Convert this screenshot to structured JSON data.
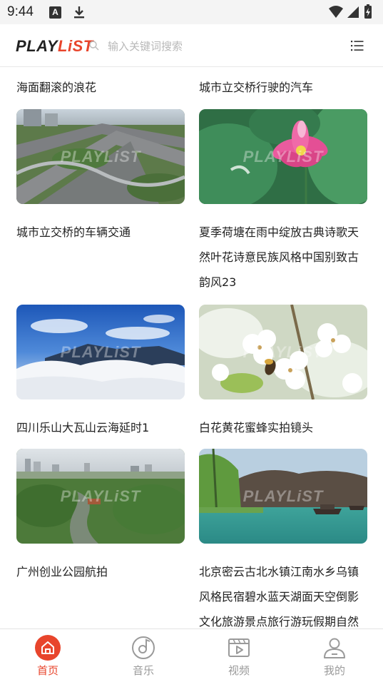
{
  "status_bar": {
    "time": "9:44",
    "notification_letter": "A"
  },
  "header": {
    "logo_play": "PLAY",
    "logo_list": "LiST",
    "search_placeholder": "输入关键词搜索"
  },
  "feed": {
    "watermark": "PLAYLiST",
    "top_titles": [
      "海面翻滚的浪花",
      "城市立交桥行驶的汽车"
    ],
    "items": [
      {
        "title": "城市立交桥的车辆交通",
        "image": "highway-interchange"
      },
      {
        "title": "夏季荷塘在雨中绽放古典诗歌天然叶花诗意民族风格中国别致古韵风23",
        "image": "lotus-flower"
      },
      {
        "title": "四川乐山大瓦山云海延时1",
        "image": "mountain-sea-of-clouds"
      },
      {
        "title": "白花黄花蜜蜂实拍镜头",
        "image": "pear-blossoms-bee"
      },
      {
        "title": "广州创业公园航拍",
        "image": "park-aerial"
      },
      {
        "title": "北京密云古北水镇江南水乡乌镇风格民宿碧水蓝天湖面天空倒影文化旅游景点旅行游玩假期自然",
        "image": "lake-boats"
      }
    ]
  },
  "bottom_nav": {
    "items": [
      {
        "label": "首页",
        "icon": "home-icon",
        "active": true
      },
      {
        "label": "音乐",
        "icon": "music-icon",
        "active": false
      },
      {
        "label": "视频",
        "icon": "video-icon",
        "active": false
      },
      {
        "label": "我的",
        "icon": "profile-icon",
        "active": false
      }
    ]
  },
  "colors": {
    "accent": "#e8452c",
    "text": "#222222",
    "inactive": "#9a9a9a"
  }
}
